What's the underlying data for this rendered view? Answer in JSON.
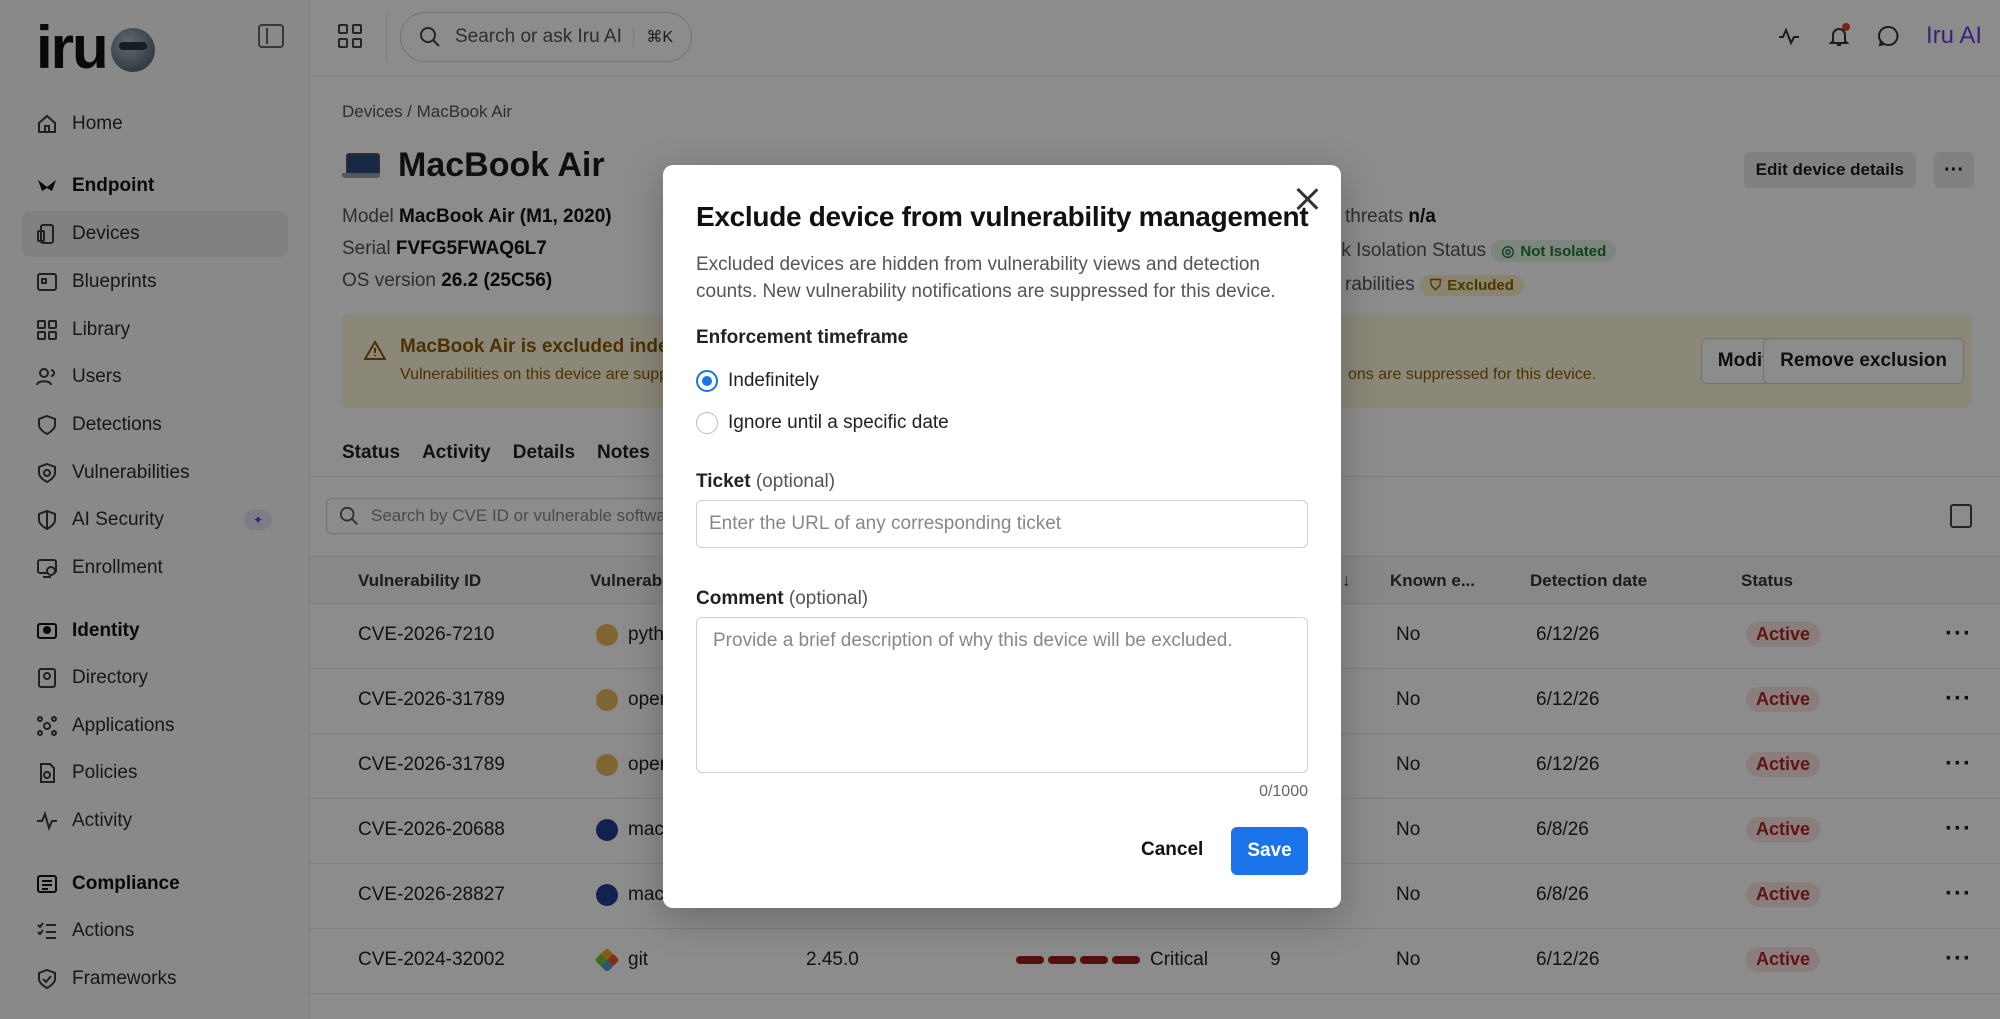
{
  "app": {
    "logo_text": "iru",
    "brand_ai": "Iru AI"
  },
  "sidebar": {
    "home": "Home",
    "sections": [
      {
        "label": "Endpoint",
        "items": [
          "Devices",
          "Blueprints",
          "Library",
          "Users",
          "Detections",
          "Vulnerabilities",
          "AI Security",
          "Enrollment"
        ]
      },
      {
        "label": "Identity",
        "items": [
          "Directory",
          "Applications",
          "Policies",
          "Activity"
        ]
      },
      {
        "label": "Compliance",
        "items": [
          "Actions",
          "Frameworks"
        ]
      }
    ],
    "active_item": "Devices"
  },
  "topbar": {
    "search_placeholder": "Search or ask Iru AI",
    "search_shortcut": "⌘K"
  },
  "device": {
    "breadcrumb": "Devices / MacBook Air",
    "title": "MacBook Air",
    "model_label": "Model",
    "model_value": "MacBook Air (M1, 2020)",
    "serial_label": "Serial",
    "serial_value": "FVFG5FWAQ6L7",
    "os_label": "OS version",
    "os_value": "26.2 (25C56)",
    "threats_label": "threats",
    "threats_value": "n/a",
    "isolation_label": "rk Isolation Status",
    "isolation_value": "Not Isolated",
    "vuln_label": "rabilities",
    "vuln_value": "Excluded",
    "edit_label": "Edit device details",
    "more_label": "···"
  },
  "banner": {
    "title": "MacBook Air is excluded indef",
    "subtitle": "Vulnerabilities on this device are supp",
    "subtitle_tail": "ons are suppressed for this device.",
    "modify": "Modify",
    "remove": "Remove exclusion"
  },
  "tabs": [
    "Status",
    "Activity",
    "Details",
    "Notes"
  ],
  "table": {
    "search_placeholder": "Search by CVE ID or vulnerable software",
    "headers": {
      "id": "Vulnerability ID",
      "software": "Vulnerabl",
      "arrow": "↓",
      "known": "Known e...",
      "date": "Detection date",
      "status": "Status"
    },
    "rows": [
      {
        "id": "CVE-2026-7210",
        "software": "pyth",
        "version": "",
        "severity": "",
        "score": "",
        "known": "No",
        "date": "6/12/26",
        "status": "Active"
      },
      {
        "id": "CVE-2026-31789",
        "software": "oper",
        "version": "",
        "severity": "",
        "score": "",
        "known": "No",
        "date": "6/12/26",
        "status": "Active"
      },
      {
        "id": "CVE-2026-31789",
        "software": "oper",
        "version": "",
        "severity": "",
        "score": "",
        "known": "No",
        "date": "6/12/26",
        "status": "Active"
      },
      {
        "id": "CVE-2026-20688",
        "software": "mac",
        "version": "",
        "severity": "",
        "score": "",
        "known": "No",
        "date": "6/8/26",
        "status": "Active"
      },
      {
        "id": "CVE-2026-28827",
        "software": "mac",
        "version": "",
        "severity": "",
        "score": "",
        "known": "No",
        "date": "6/8/26",
        "status": "Active"
      },
      {
        "id": "CVE-2024-32002",
        "software": "git",
        "version": "2.45.0",
        "severity": "Critical",
        "score": "9",
        "known": "No",
        "date": "6/12/26",
        "status": "Active"
      }
    ],
    "row_more": "···"
  },
  "modal": {
    "title": "Exclude device from vulnerability management",
    "description": "Excluded devices are hidden from vulnerability views and detection counts. New vulnerability notifications are suppressed for this device.",
    "timeframe_label": "Enforcement timeframe",
    "option_indefinitely": "Indefinitely",
    "option_date": "Ignore until a specific date",
    "ticket_label": "Ticket",
    "optional": "(optional)",
    "ticket_placeholder": "Enter the URL of any corresponding ticket",
    "comment_label": "Comment",
    "comment_placeholder": "Provide a brief description of why this device will be excluded.",
    "counter": "0/1000",
    "cancel": "Cancel",
    "save": "Save"
  },
  "colors": {
    "accent": "#1a73e8",
    "brand_ai": "#6a3fd9",
    "danger": "#b3261e"
  }
}
